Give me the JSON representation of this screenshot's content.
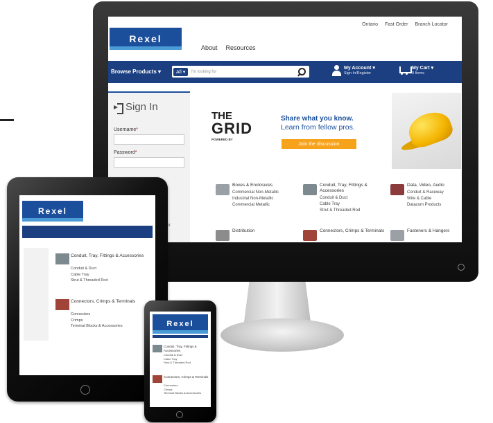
{
  "brand": {
    "logo": "Rexel",
    "accent": "#1b4f9c",
    "navbar_color": "#1b3f80",
    "cta_color": "#f7a21b"
  },
  "desktop": {
    "top_links": [
      "Ontario",
      "Fast Order",
      "Branch Locator"
    ],
    "nav_links": [
      "About",
      "Resources"
    ],
    "browse_label": "Browse Products ▾",
    "search": {
      "category": "All ▾",
      "placeholder": "I'm looking for"
    },
    "account": {
      "label": "My Account ▾",
      "sub": "Sign In/Register"
    },
    "cart": {
      "label": "My Cart ▾",
      "sub": "0 Items"
    },
    "signin": {
      "title": "Sign In",
      "username_label": "Username",
      "password_label": "Password",
      "required_mark": "*",
      "partial_text": "or"
    },
    "banner": {
      "grid_line1": "THE",
      "grid_line2": "GRID",
      "powered": "POWERED BY",
      "headline": "Share what you know.",
      "subhead": "Learn from fellow pros.",
      "cta": "Join the discussion"
    },
    "categories": [
      {
        "title": "Boxes & Enclosures",
        "links": [
          "Commercial Non-Metallic",
          "Industrial Non-Metallic",
          "Commercial Metallic"
        ],
        "thumb": "#9aa0a6"
      },
      {
        "title": "Conduit, Tray, Fittings & Accessories",
        "links": [
          "Conduit & Duct",
          "Cable Tray",
          "Strut & Threaded Rod"
        ],
        "thumb": "#7c8a90"
      },
      {
        "title": "Data, Video, Audio",
        "links": [
          "Conduit & Raceway",
          "Wire & Cable",
          "Datacom Products"
        ],
        "thumb": "#8b3b3b"
      },
      {
        "title": "Distribution",
        "links": [],
        "thumb": "#8c8c8c"
      },
      {
        "title": "Connectors, Crimps & Terminals",
        "links": [],
        "thumb": "#a0443a"
      },
      {
        "title": "Fasteners & Hangers",
        "links": [],
        "thumb": "#9aa0a6"
      }
    ]
  },
  "tablet": {
    "categories": [
      {
        "title": "Conduit, Tray, Fittings & Accessories",
        "links": [
          "Conduit & Duct",
          "Cable Tray",
          "Strut & Threaded Rod"
        ],
        "thumb": "#7c8a90"
      },
      {
        "title": "Connectors, Crimps & Terminals",
        "links": [
          "Connectors",
          "Crimps",
          "Terminal Blocks & Accessories"
        ],
        "thumb": "#a0443a"
      }
    ]
  },
  "phone": {
    "categories": [
      {
        "title": "Conduit, Tray, Fittings & Accessories",
        "links": [
          "Conduit & Duct",
          "Cable Tray",
          "Strut & Threaded Rod"
        ],
        "thumb": "#7c8a90"
      },
      {
        "title": "Connectors, Crimps & Terminals",
        "links": [
          "Connectors",
          "Crimps",
          "Terminal Blocks & Accessories"
        ],
        "thumb": "#a0443a"
      }
    ]
  }
}
